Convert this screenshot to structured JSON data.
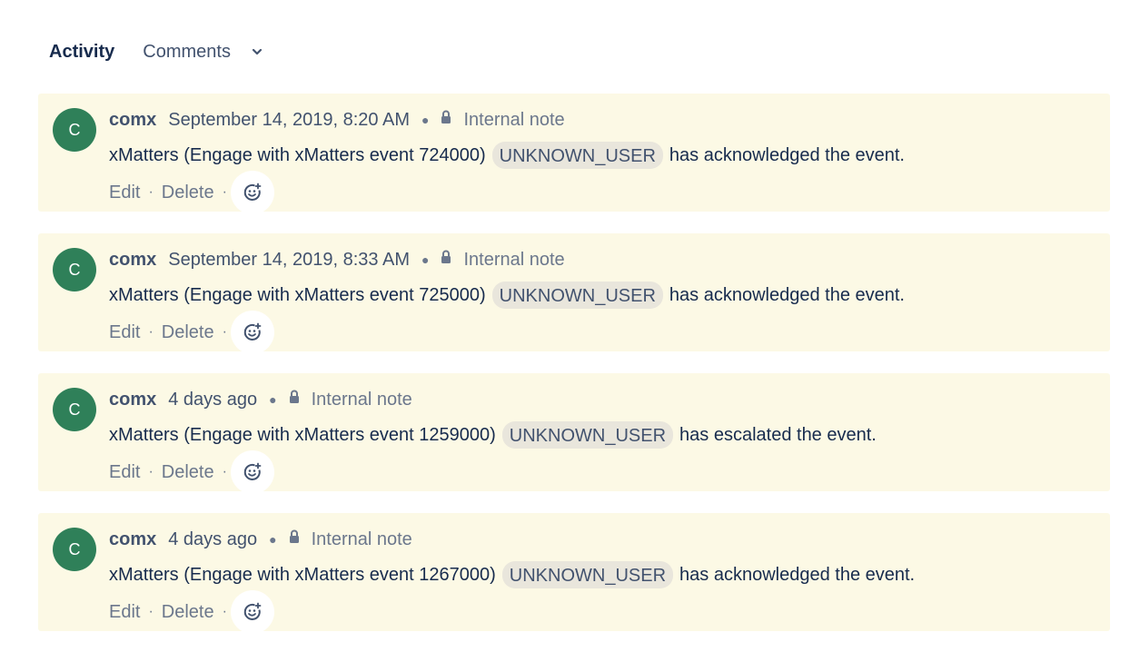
{
  "tabs": {
    "activity": "Activity",
    "comments": "Comments"
  },
  "icons": {
    "dropdown": "chevron-down-icon",
    "lock": "lock-icon",
    "reaction": "add-reaction-icon"
  },
  "colors": {
    "card_bg": "#fcf9e5",
    "avatar_bg": "#2f8059"
  },
  "comments": [
    {
      "avatar": "C",
      "author": "comx",
      "time": "September 14, 2019, 8:20 AM",
      "note": "Internal note",
      "text_before": "xMatters (Engage with xMatters event 724000)",
      "mention": "UNKNOWN_USER",
      "text_after": "has acknowledged the event.",
      "edit": "Edit",
      "delete": "Delete",
      "sep": "·"
    },
    {
      "avatar": "C",
      "author": "comx",
      "time": "September 14, 2019, 8:33 AM",
      "note": "Internal note",
      "text_before": "xMatters (Engage with xMatters event 725000)",
      "mention": "UNKNOWN_USER",
      "text_after": "has acknowledged the event.",
      "edit": "Edit",
      "delete": "Delete",
      "sep": "·"
    },
    {
      "avatar": "C",
      "author": "comx",
      "time": "4 days ago",
      "note": "Internal note",
      "text_before": "xMatters (Engage with xMatters event 1259000)",
      "mention": "UNKNOWN_USER",
      "text_after": "has escalated the event.",
      "edit": "Edit",
      "delete": "Delete",
      "sep": "·"
    },
    {
      "avatar": "C",
      "author": "comx",
      "time": "4 days ago",
      "note": "Internal note",
      "text_before": "xMatters (Engage with xMatters event 1267000)",
      "mention": "UNKNOWN_USER",
      "text_after": "has acknowledged the event.",
      "edit": "Edit",
      "delete": "Delete",
      "sep": "·"
    }
  ]
}
